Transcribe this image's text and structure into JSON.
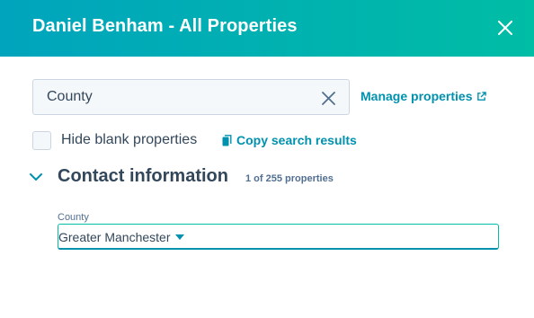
{
  "header": {
    "title": "Daniel Benham - All Properties",
    "close_icon": "close-icon"
  },
  "search": {
    "value": "County",
    "clear_icon": "clear-icon"
  },
  "manage": {
    "label": "Manage properties",
    "icon": "external-link-icon"
  },
  "options": {
    "hide_blank_label": "Hide blank properties",
    "hide_blank_checked": false
  },
  "copy": {
    "label": "Copy search results",
    "icon": "copy-icon"
  },
  "section": {
    "title": "Contact information",
    "count": "1 of 255 properties",
    "toggle_icon": "chevron-down-icon",
    "expanded": true
  },
  "field": {
    "label": "County",
    "value": "Greater Manchester",
    "dropdown_icon": "caret-down-icon"
  },
  "colors": {
    "header_gradient_start": "#00a4bd",
    "header_gradient_end": "#00bda5",
    "link": "#0091ae",
    "text": "#33475b"
  }
}
